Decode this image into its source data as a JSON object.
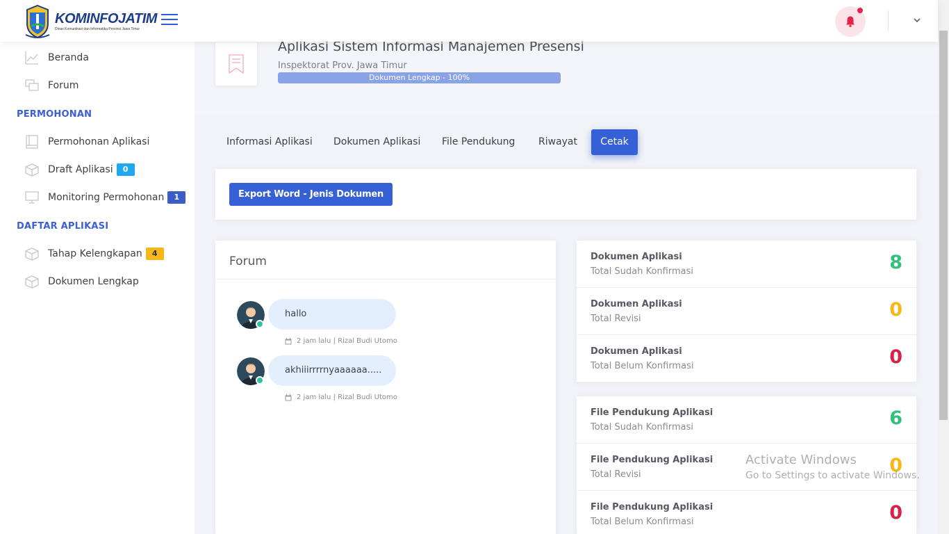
{
  "header": {
    "logo_text_a": "KOMINFO",
    "logo_text_b": "JATIM",
    "logo_sub": "Dinas Komunikasi dan Informatika Provinsi Jawa Timur",
    "icons": [
      "menu-icon",
      "bell-icon",
      "chevron-down-icon"
    ]
  },
  "sidebar": {
    "items_top": [
      {
        "label": "Beranda",
        "icon": "chart-line-icon"
      },
      {
        "label": "Forum",
        "icon": "chat-icon"
      }
    ],
    "section_permohonan": "PERMOHONAN",
    "permohonan_items": [
      {
        "label": "Permohonan Aplikasi",
        "icon": "book-icon",
        "badge": ""
      },
      {
        "label": "Draft Aplikasi",
        "icon": "box-icon",
        "badge": "0"
      },
      {
        "label": "Monitoring Permohonan",
        "icon": "monitor-icon",
        "badge": "1"
      }
    ],
    "section_daftar": "DAFTAR APLIKASI",
    "daftar_items": [
      {
        "label": "Tahap Kelengkapan",
        "icon": "box-icon",
        "badge": "4"
      },
      {
        "label": "Dokumen Lengkap",
        "icon": "box-icon",
        "badge": ""
      }
    ]
  },
  "app": {
    "title": "Aplikasi Sistem Informasi Manajemen Presensi",
    "subtitle": "Inspektorat Prov. Jawa Timur",
    "progress_label": "Dokumen Lengkap - 100%",
    "progress_percent": 100
  },
  "tabs": [
    {
      "label": "Informasi Aplikasi",
      "active": false
    },
    {
      "label": "Dokumen Aplikasi",
      "active": false
    },
    {
      "label": "File Pendukung",
      "active": false
    },
    {
      "label": "Riwayat",
      "active": false
    },
    {
      "label": "Cetak",
      "active": true
    }
  ],
  "export_button": "Export Word - Jenis Dokumen",
  "forum": {
    "title": "Forum",
    "messages": [
      {
        "text": "hallo",
        "meta": "2 jam lalu | Rizal Budi Utomo"
      },
      {
        "text": "akhiiirrrrnyaaaaaa.....",
        "meta": "2 jam lalu | Rizal Budi Utomo"
      }
    ]
  },
  "stats_dokumen": [
    {
      "title": "Dokumen Aplikasi",
      "sub": "Total Sudah Konfirmasi",
      "value": "8",
      "color": "#34bf7a"
    },
    {
      "title": "Dokumen Aplikasi",
      "sub": "Total Revisi",
      "value": "0",
      "color": "#f5b71a"
    },
    {
      "title": "Dokumen Aplikasi",
      "sub": "Total Belum Konfirmasi",
      "value": "0",
      "color": "#d7214a"
    }
  ],
  "stats_file": [
    {
      "title": "File Pendukung Aplikasi",
      "sub": "Total Sudah Konfirmasi",
      "value": "6",
      "color": "#34bf7a"
    },
    {
      "title": "File Pendukung Aplikasi",
      "sub": "Total Revisi",
      "value": "0",
      "color": "#f5b71a"
    },
    {
      "title": "File Pendukung Aplikasi",
      "sub": "Total Belum Konfirmasi",
      "value": "0",
      "color": "#d7214a"
    }
  ],
  "watermark": {
    "line1": "Activate Windows",
    "line2": "Go to Settings to activate Windows."
  },
  "colors": {
    "accent": "#3560d6",
    "sidebar_head": "#3a5fd6"
  }
}
